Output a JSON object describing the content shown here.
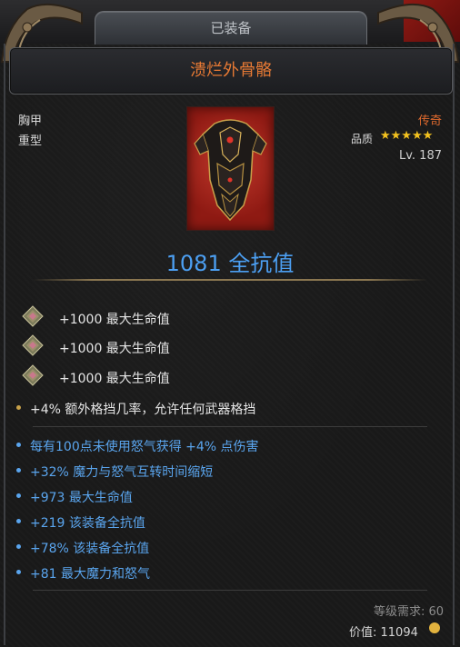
{
  "header": {
    "tab_label": "已装备"
  },
  "item": {
    "name": "溃烂外骨骼",
    "slot": "胸甲",
    "weight": "重型",
    "rarity": "传奇",
    "quality_label": "品质",
    "quality_stars": "★★★★★",
    "level": "Lv. 187",
    "armor_value": "1081 全抗值"
  },
  "gem_affixes": [
    {
      "text": "+1000 最大生命值"
    },
    {
      "text": "+1000 最大生命值"
    },
    {
      "text": "+1000 最大生命值"
    }
  ],
  "implicit_affixes": [
    {
      "text": "+4% 额外格挡几率，允许任何武器格挡"
    }
  ],
  "affixes": [
    {
      "text": "每有100点未使用怒气获得 +4% 点伤害"
    },
    {
      "text": "+32% 魔力与怒气互转时间缩短"
    },
    {
      "text": "+973 最大生命值"
    },
    {
      "text": "+219 该装备全抗值"
    },
    {
      "text": "+78% 该装备全抗值"
    },
    {
      "text": "+81 最大魔力和怒气"
    }
  ],
  "footer": {
    "requirement": "等级需求: 60",
    "price": "价值: 11094"
  },
  "colors": {
    "legendary": "#e87a34",
    "magic_blue": "#5aa5ee",
    "armor_blue": "#4c9ff2",
    "star_gold": "#f3c21f"
  }
}
